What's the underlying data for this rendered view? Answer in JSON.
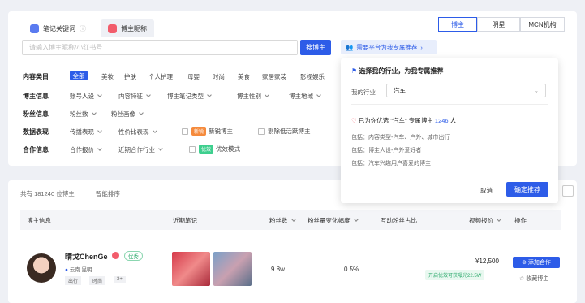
{
  "tabs": [
    {
      "label": "笔记关键词",
      "active": false
    },
    {
      "label": "博主昵称",
      "active": true
    }
  ],
  "category_switch": [
    "博主",
    "明星",
    "MCN机构"
  ],
  "search": {
    "placeholder": "请输入博主昵称/小红书号",
    "button": "搜博主"
  },
  "recommend_link": "需要平台为我专属推荐",
  "filters": {
    "content_category": {
      "label": "内容类目",
      "options": [
        "全部",
        "美妆",
        "护肤",
        "个人护理",
        "母婴",
        "时尚",
        "美食",
        "家居家装",
        "影视娱乐"
      ]
    },
    "blogger_info": {
      "label": "博主信息",
      "options": [
        "账号人设",
        "内容特征",
        "博主笔记类型",
        "博主性别",
        "博主地域"
      ]
    },
    "fans_info": {
      "label": "粉丝信息",
      "options": [
        "粉丝数",
        "粉丝画像"
      ]
    },
    "data_performance": {
      "label": "数据表现",
      "options": [
        "传播表现",
        "性价比表现"
      ],
      "new_tag": "新锐",
      "new_blogger": "新锐博主",
      "exclude_low_active": "剔除低活跃博主"
    },
    "cooperation_info": {
      "label": "合作信息",
      "options": [
        "合作报价",
        "近期合作行业"
      ],
      "good_tag": "优效",
      "good_mode": "优效模式"
    }
  },
  "popup": {
    "title": "选择我的行业，为我专属推荐",
    "industry_label": "我的行业",
    "industry_value": "汽车",
    "result_prefix": "已为你优选 \"汽车\" 专属博主",
    "result_count": "1246",
    "result_unit": "人",
    "includes": [
      "包括：内容类型-汽车、户外、城市出行",
      "包括：博主人设-户外爱好者",
      "包括：汽车兴趣用户喜爱的博主"
    ],
    "cancel": "取消",
    "confirm": "确定推荐"
  },
  "list": {
    "total": "共有 181240 位博主",
    "sort": "智能排序",
    "columns": [
      "博主信息",
      "近期笔记",
      "粉丝数",
      "粉丝量变化幅度",
      "互动粉丝占比",
      "视频报价",
      "操作"
    ],
    "rows": [
      {
        "name": "晴戈ChenGe",
        "badge": "优秀",
        "location": "云南 昆明",
        "tags": [
          "出行",
          "时尚",
          "3+"
        ],
        "fans": "9.8w",
        "fans_change": "0.5%",
        "price": "¥12,500",
        "price_note": "开启优效可获曝光22.5W",
        "add_button": "添加合作",
        "fav_button": "收藏博主"
      }
    ]
  },
  "colors": {
    "primary": "#2d5ce8",
    "background": "#eef0f5",
    "orange": "#f58a3c",
    "green": "#3ecf8e"
  }
}
